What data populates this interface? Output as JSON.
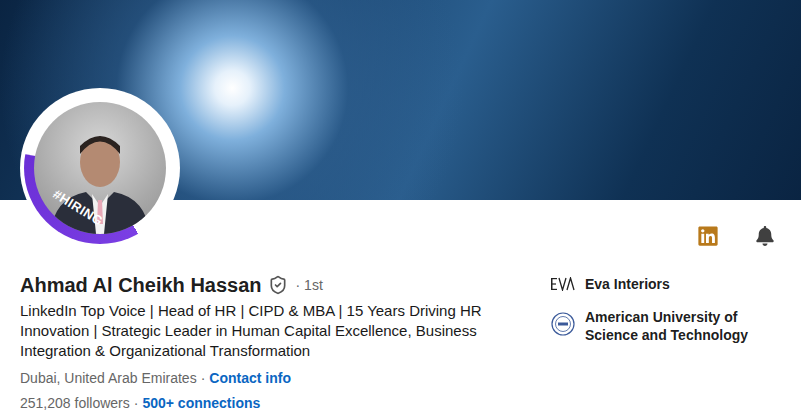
{
  "profile": {
    "name": "Ahmad Al Cheikh Hassan",
    "verified": true,
    "degree": "1st",
    "separator": "·",
    "headline": "LinkedIn Top Voice | Head of HR | CIPD & MBA | 15 Years Driving HR Innovation | Strategic Leader in Human Capital Excellence, Business Integration & Organizational Transformation",
    "location": "Dubai, United Arab Emirates",
    "contact_link": "Contact info",
    "followers": "251,208 followers",
    "connections": "500+ connections",
    "photo_badge": "#HIRING"
  },
  "highlights": [
    {
      "name": "Eva Interiors",
      "kind": "company"
    },
    {
      "name": "American University of Science and Technology",
      "kind": "school"
    }
  ]
}
